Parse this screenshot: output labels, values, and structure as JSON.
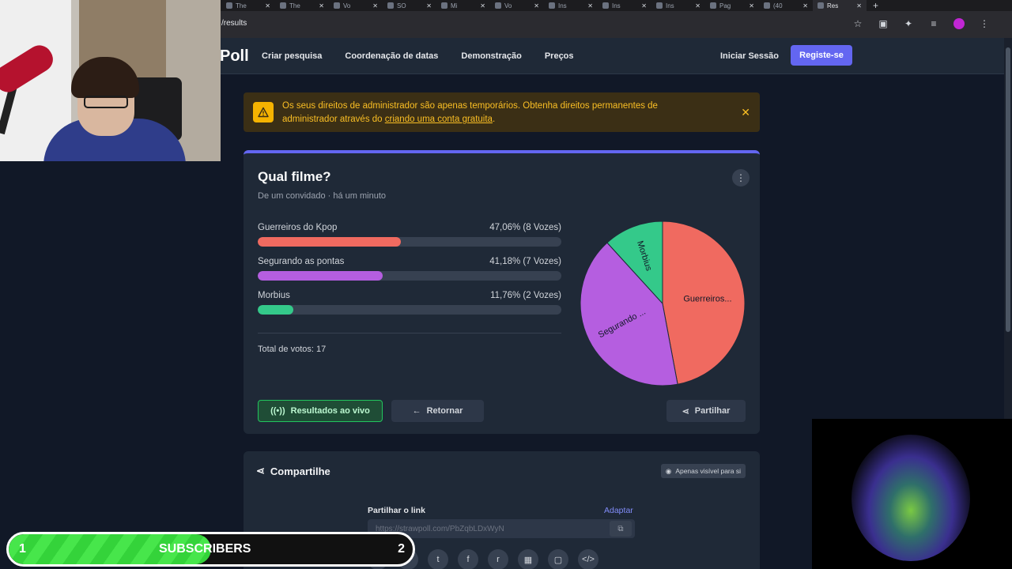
{
  "browser": {
    "tabs": [
      {
        "label": "The"
      },
      {
        "label": "The"
      },
      {
        "label": "Vo"
      },
      {
        "label": "SO"
      },
      {
        "label": "Mi"
      },
      {
        "label": "Vo"
      },
      {
        "label": "Ins"
      },
      {
        "label": "Ins"
      },
      {
        "label": "Ins"
      },
      {
        "label": "Pag"
      },
      {
        "label": "(40"
      },
      {
        "label": "Res"
      }
    ],
    "url": "/results"
  },
  "nav": {
    "logo": "Poll",
    "links": [
      "Criar pesquisa",
      "Coordenação de datas",
      "Demonstração",
      "Preços"
    ],
    "login": "Iniciar Sessão",
    "signup": "Registe-se"
  },
  "warning": {
    "text_before": "Os seus direitos de administrador são apenas temporários. Obtenha direitos permanentes de administrador através do ",
    "link": "criando uma conta gratuita",
    "text_after": "."
  },
  "poll": {
    "title": "Qual filme?",
    "subtitle": "De um convidado · há um minuto",
    "options": [
      {
        "label": "Guerreiros do Kpop",
        "result": "47,06% (8 Vozes)",
        "percent": 47.06,
        "color": "#f06a60"
      },
      {
        "label": "Segurando as pontas",
        "result": "41,18% (7 Vozes)",
        "percent": 41.18,
        "color": "#b55ee0"
      },
      {
        "label": "Morbius",
        "result": "11,76% (2 Vozes)",
        "percent": 11.76,
        "color": "#34c98a"
      }
    ],
    "total": "Total de votos: 17",
    "pie_labels": [
      "Guerreiros...",
      "Segurando ...",
      "Morbius"
    ],
    "buttons": {
      "live": "Resultados ao vivo",
      "back": "Retornar",
      "share": "Partilhar"
    }
  },
  "share_card": {
    "title": "Compartilhe",
    "badge": "Apenas visível para si",
    "share_label": "Partilhar o link",
    "adapt": "Adaptar",
    "link": "https://strawpoll.com/PbZqbLDxWyN"
  },
  "overlay": {
    "subs_left": "1",
    "subs_label": "SUBSCRIBERS",
    "subs_right": "2",
    "subs_progress": 0.5
  }
}
